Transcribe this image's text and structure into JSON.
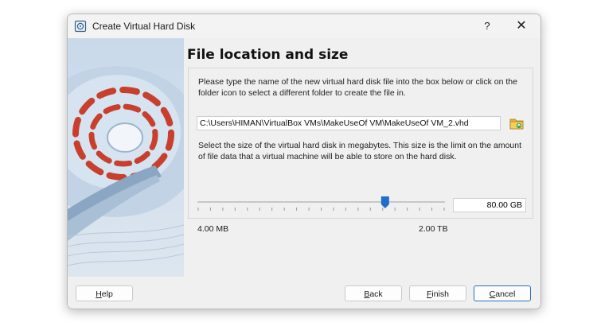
{
  "window": {
    "title": "Create Virtual Hard Disk",
    "help_glyph": "?",
    "close_glyph": "✕"
  },
  "page": {
    "heading": "File location and size",
    "location_description": "Please type the name of the new virtual hard disk file into the box below or click on the folder icon to select a different folder to create the file in.",
    "file_path": "C:\\Users\\HIMAN\\VirtualBox VMs\\MakeUseOf VM\\MakeUseOf VM_2.vhd",
    "size_description": "Select the size of the virtual hard disk in megabytes. This size is the limit on the amount of file data that a virtual machine will be able to store on the hard disk.",
    "size_value": "80.00 GB",
    "size_min_label": "4.00 MB",
    "size_max_label": "2.00 TB",
    "slider_position": 0.76
  },
  "buttons": {
    "help": {
      "mnemonic": "H",
      "rest": "elp"
    },
    "back": {
      "mnemonic": "B",
      "rest": "ack"
    },
    "finish": {
      "mnemonic": "F",
      "rest": "inish"
    },
    "cancel": {
      "mnemonic": "C",
      "rest": "ancel"
    }
  },
  "colors": {
    "accent": "#2c6fbe",
    "slider_handle": "#1f6fc9",
    "illustration_red": "#c8402d",
    "illustration_blue": "#8aa6c2"
  }
}
